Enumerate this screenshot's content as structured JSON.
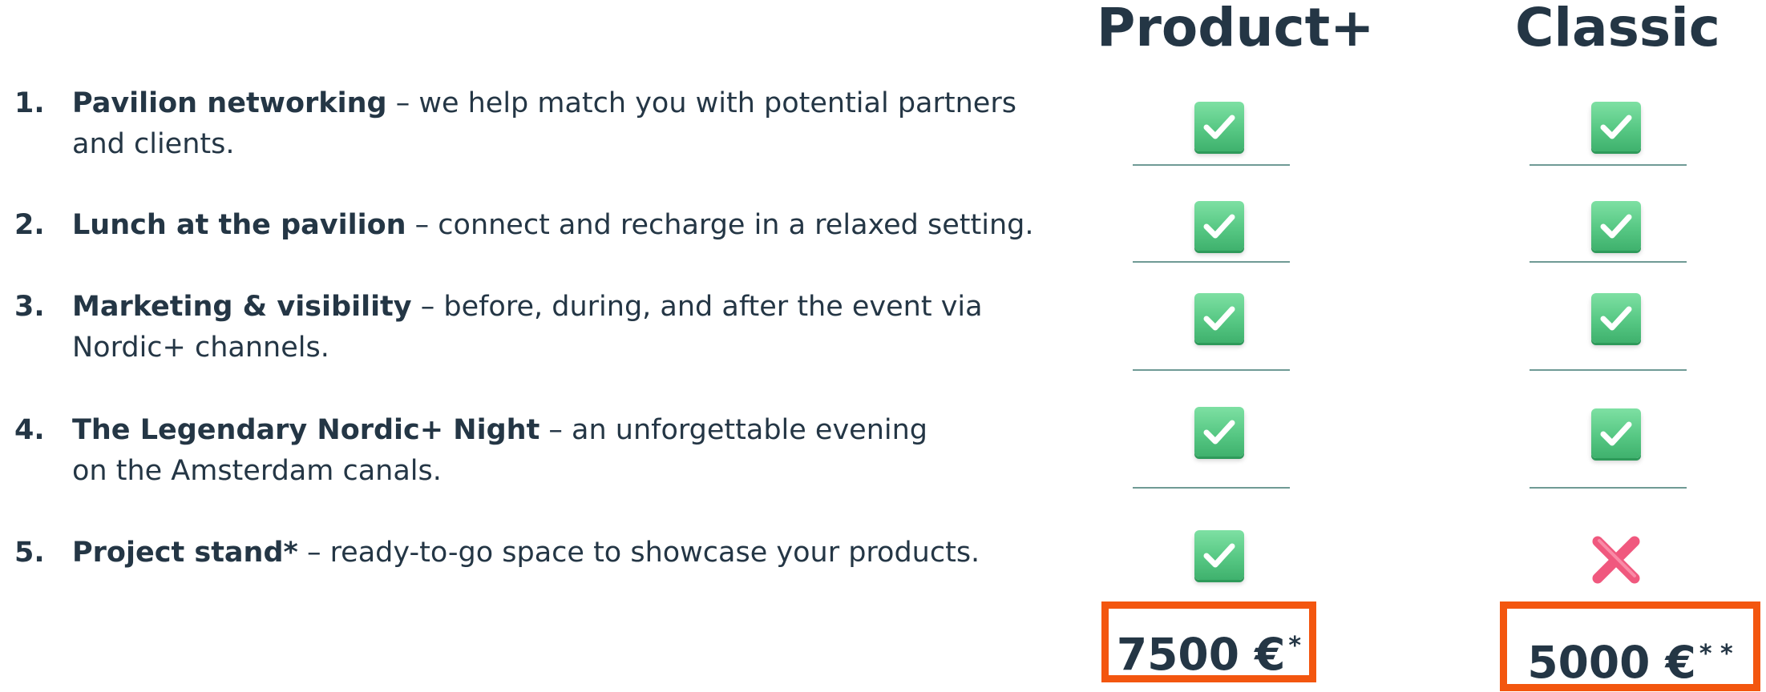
{
  "columns": {
    "product_plus": "Product+",
    "classic": "Classic"
  },
  "features": [
    {
      "number": "1.",
      "title": "Pavilion networking",
      "description": " – we help match you with potential partners and clients.",
      "product_plus": "check",
      "classic": "check"
    },
    {
      "number": "2.",
      "title": "Lunch at the pavilion",
      "description": " – connect and recharge in a relaxed setting.",
      "product_plus": "check",
      "classic": "check"
    },
    {
      "number": "3.",
      "title": "Marketing & visibility",
      "description": " – before, during, and after the event via Nordic+ channels.",
      "product_plus": "check",
      "classic": "check"
    },
    {
      "number": "4.",
      "title": "The Legendary Nordic+ Night",
      "description": " – an unforgettable evening on the Amsterdam canals.",
      "product_plus": "check",
      "classic": "check"
    },
    {
      "number": "5.",
      "title": "Project stand*",
      "description": " – ready-to-go space to showcase your products.",
      "product_plus": "check",
      "classic": "cross"
    }
  ],
  "prices": {
    "product_plus": {
      "amount": "7500 €",
      "marker": "*"
    },
    "classic": {
      "amount": "5000 €",
      "marker": "* *"
    }
  },
  "colors": {
    "text": "#243645",
    "price_border": "#f3560f",
    "check": "#57c884",
    "cross": "#f0587e",
    "rule": "#6f9a95"
  },
  "icons": {
    "included": "checkmark-icon",
    "excluded": "cross-icon"
  }
}
